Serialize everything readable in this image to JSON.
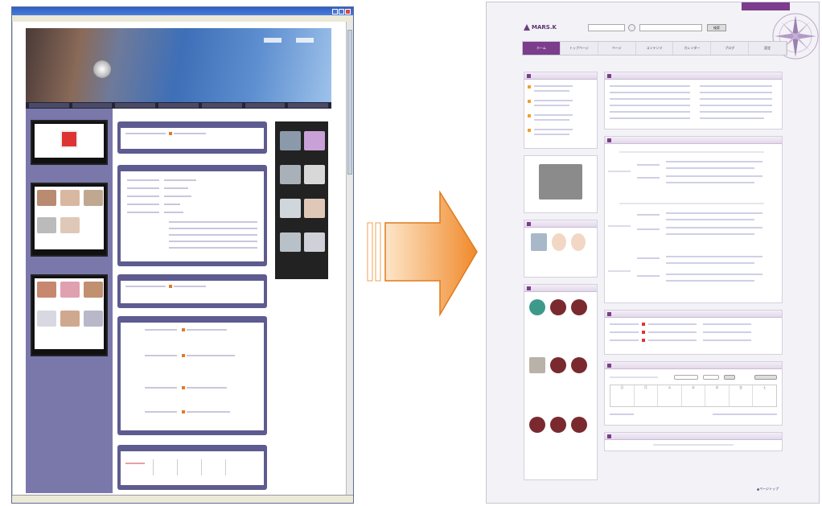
{
  "new_site": {
    "logo_text": "MARS.K",
    "nav_tabs": [
      "ホーム",
      "トップページ",
      "ページ",
      "コンテンツ",
      "カレンダー",
      "ブログ",
      "設定"
    ],
    "search_button": "検索",
    "schedule": {
      "days": [
        "日",
        "月",
        "火",
        "水",
        "木",
        "金",
        "土"
      ]
    },
    "footer_pagetop": "▲ページトップ"
  },
  "colors": {
    "new_accent": "#7b3d8c",
    "old_frame": "#5d5b8f",
    "arrow": "#f0923a"
  }
}
